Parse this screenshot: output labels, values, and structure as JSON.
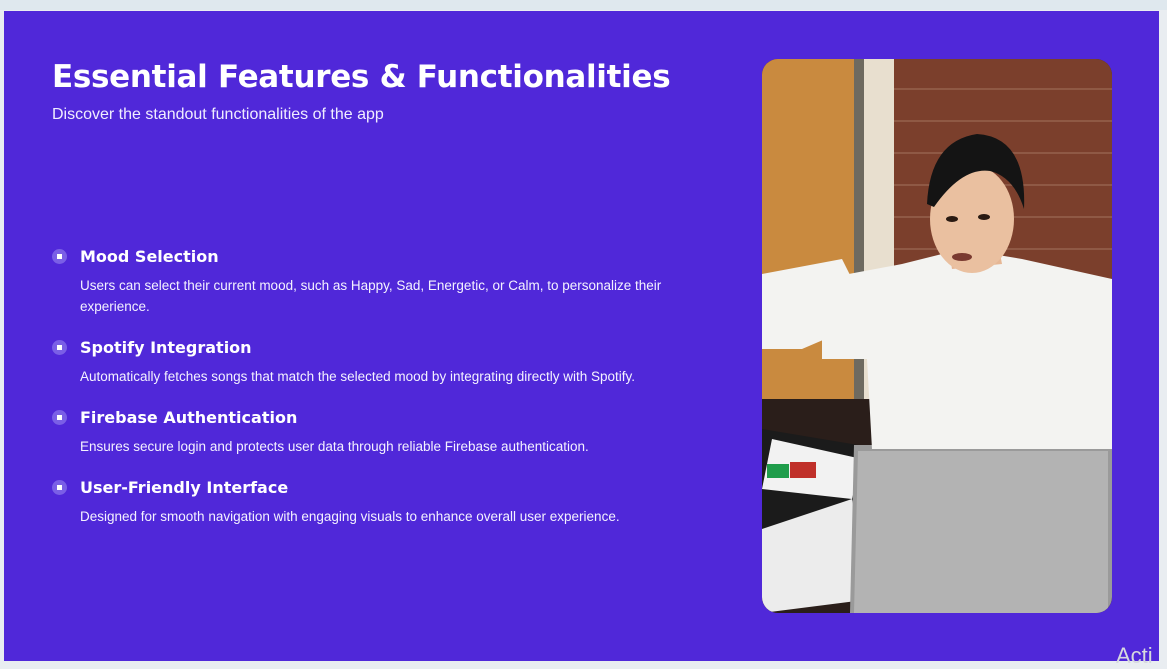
{
  "slide": {
    "title": "Essential Features & Functionalities",
    "subtitle": "Discover the standout functionalities of the app",
    "features": [
      {
        "title": "Mood Selection",
        "description": "Users can select their current mood, such as Happy, Sad, Energetic, or Calm, to personalize their experience."
      },
      {
        "title": "Spotify Integration",
        "description": "Automatically fetches songs that match the selected mood by integrating directly with Spotify."
      },
      {
        "title": "Firebase Authentication",
        "description": "Ensures secure login and protects user data through reliable Firebase authentication."
      },
      {
        "title": "User-Friendly Interface",
        "description": "Designed for smooth navigation with engaging visuals to enhance overall user experience."
      }
    ],
    "icons": {
      "bullet": "bullet-dot-icon"
    },
    "colors": {
      "background": "#5028d9",
      "text": "#ffffff",
      "bullet": "#7a5fe6"
    }
  },
  "watermark": "Acti"
}
